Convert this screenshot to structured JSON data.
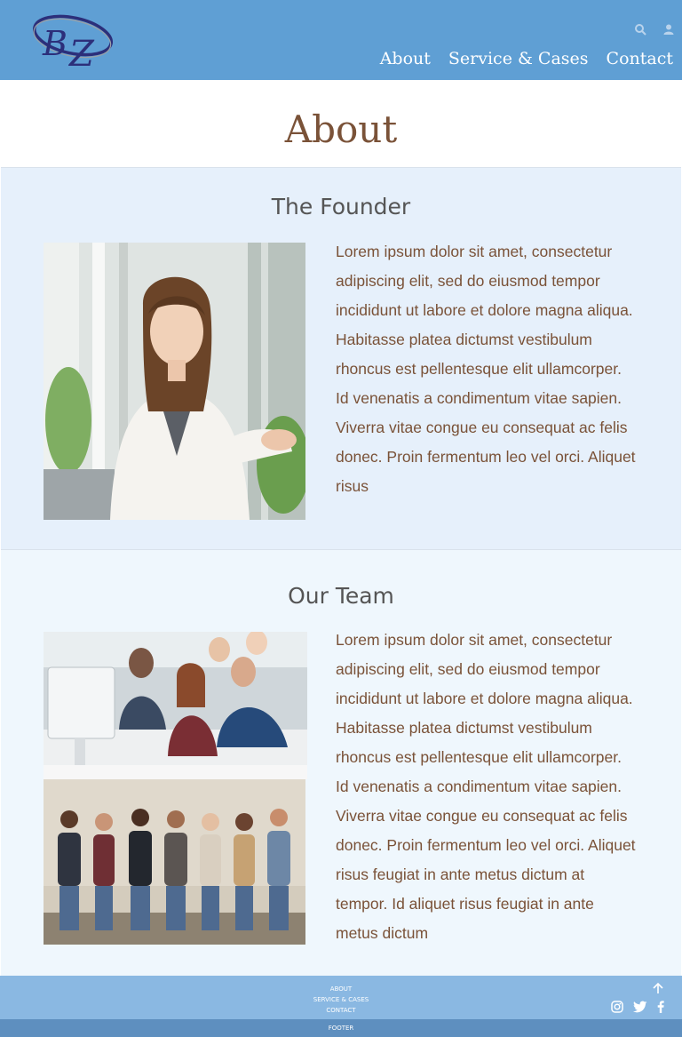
{
  "header": {
    "logo_text": "BZ",
    "icons": [
      "search-icon",
      "user-icon"
    ],
    "nav": [
      {
        "label": "About"
      },
      {
        "label": "Service & Cases"
      },
      {
        "label": "Contact"
      }
    ]
  },
  "page": {
    "title": "About"
  },
  "founder": {
    "title": "The Founder",
    "text": "Lorem ipsum dolor sit amet, consectetur adipiscing elit, sed do eiusmod tempor incididunt ut labore et dolore magna aliqua. Habitasse platea dictumst vestibulum rhoncus est pellentesque elit ullamcorper. Id venenatis a condimentum vitae sapien. Viverra vitae congue eu consequat ac felis donec. Proin fermentum leo vel orci. Aliquet risus"
  },
  "team": {
    "title": "Our Team",
    "text": "Lorem ipsum dolor sit amet, consectetur adipiscing elit, sed do eiusmod tempor incididunt ut labore et dolore magna aliqua. Habitasse platea dictumst vestibulum rhoncus est pellentesque elit ullamcorper. Id venenatis a condimentum vitae sapien. Viverra vitae congue eu consequat ac felis donec. Proin fermentum leo vel orci. Aliquet risus feugiat in ante metus dictum at tempor. Id aliquet risus feugiat in ante metus dictum"
  },
  "footer": {
    "links": [
      {
        "label": "ABOUT"
      },
      {
        "label": "SERVICE & CASES"
      },
      {
        "label": "CONTACT"
      }
    ],
    "icons": [
      "arrow-up-icon",
      "instagram-icon",
      "twitter-icon",
      "facebook-icon"
    ],
    "bottom_label": "FOOTER"
  },
  "colors": {
    "header_bg": "#5f9fd4",
    "title_brown": "#7a5238",
    "founder_bg": "#e6f0fb",
    "team_bg": "#eff7fd",
    "footer_bg": "#8ab8e2",
    "footer_bar_bg": "#5e8fbf"
  }
}
